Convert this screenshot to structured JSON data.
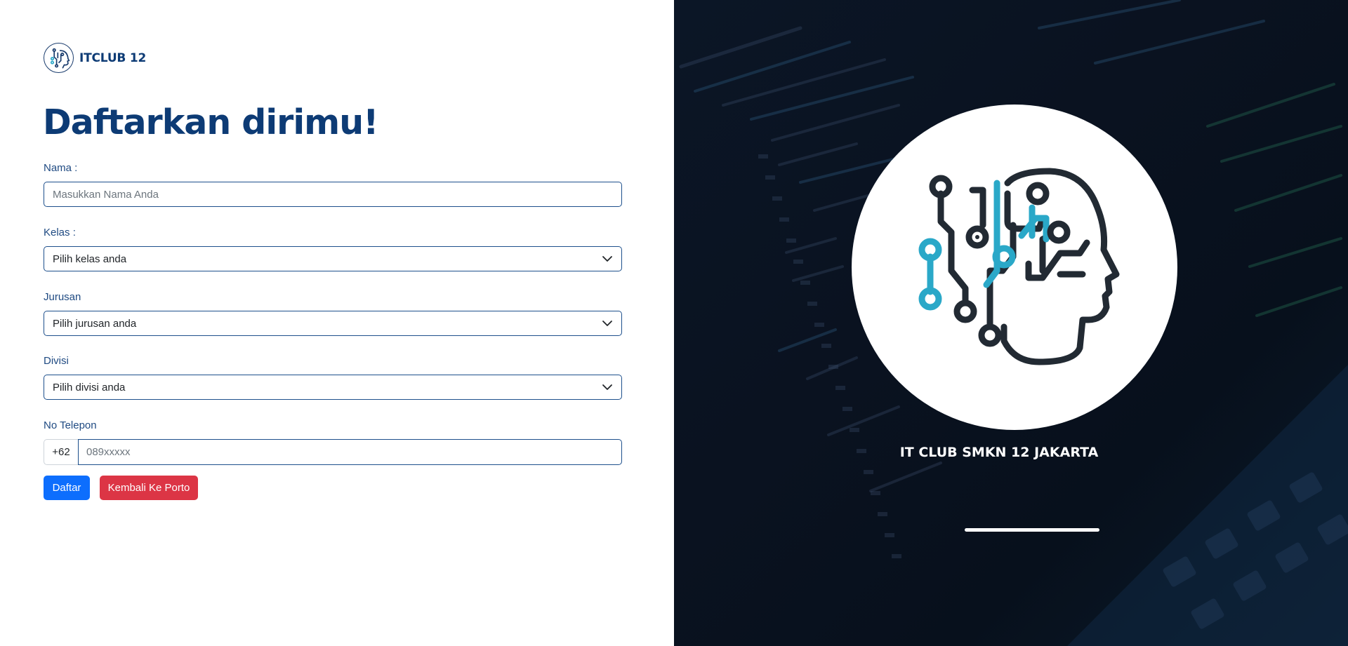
{
  "brand": {
    "name": "ITCLUB 12",
    "logo_icon": "ai-head-circuit-icon"
  },
  "form": {
    "title": "Daftarkan dirimu!",
    "nama": {
      "label": "Nama :",
      "placeholder": "Masukkan Nama Anda"
    },
    "kelas": {
      "label": "Kelas :",
      "selected": "Pilih kelas anda"
    },
    "jurusan": {
      "label": "Jurusan",
      "selected": "Pilih jurusan anda"
    },
    "divisi": {
      "label": "Divisi",
      "selected": "Pilih divisi anda"
    },
    "telepon": {
      "label": "No Telepon",
      "prefix": "+62",
      "placeholder": "089xxxxx"
    },
    "buttons": {
      "submit": "Daftar",
      "back": "Kembali Ke Porto"
    }
  },
  "hero": {
    "club_name": "IT CLUB SMKN 12 JAKARTA",
    "logo_icon": "ai-head-circuit-icon"
  },
  "colors": {
    "primary": "#0d3b75",
    "button_primary": "#0d6efd",
    "button_danger": "#dc3545",
    "panel_bg": "#0a1220",
    "accent_teal": "#2aa8c8"
  }
}
